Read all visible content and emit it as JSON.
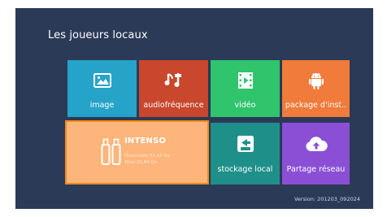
{
  "screen": {
    "title": "Les joueurs locaux",
    "version": "Version:  201203_092024"
  },
  "tiles": {
    "image": {
      "label": "image",
      "icon": "image-icon",
      "color": "#26a3c9"
    },
    "audio": {
      "label": "audiofréquence",
      "icon": "music-icon",
      "color": "#c8472d"
    },
    "video": {
      "label": "vidéo",
      "icon": "film-icon",
      "color": "#30c46c"
    },
    "package": {
      "label": "package d'inst..",
      "icon": "android-icon",
      "color": "#f07b3a"
    },
    "usb": {
      "name": "INTENSO",
      "available": "Disponible:31,43 Go",
      "total": "Total:31,44 Go",
      "icon": "usb-drive-icon",
      "color": "#fdb57b",
      "border": "#f28a18"
    },
    "local": {
      "label": "stockage local",
      "icon": "local-storage-icon",
      "color": "#1f8f8a"
    },
    "network": {
      "label": "Partage réseau",
      "icon": "cloud-upload-icon",
      "color": "#8b4fd6"
    }
  }
}
